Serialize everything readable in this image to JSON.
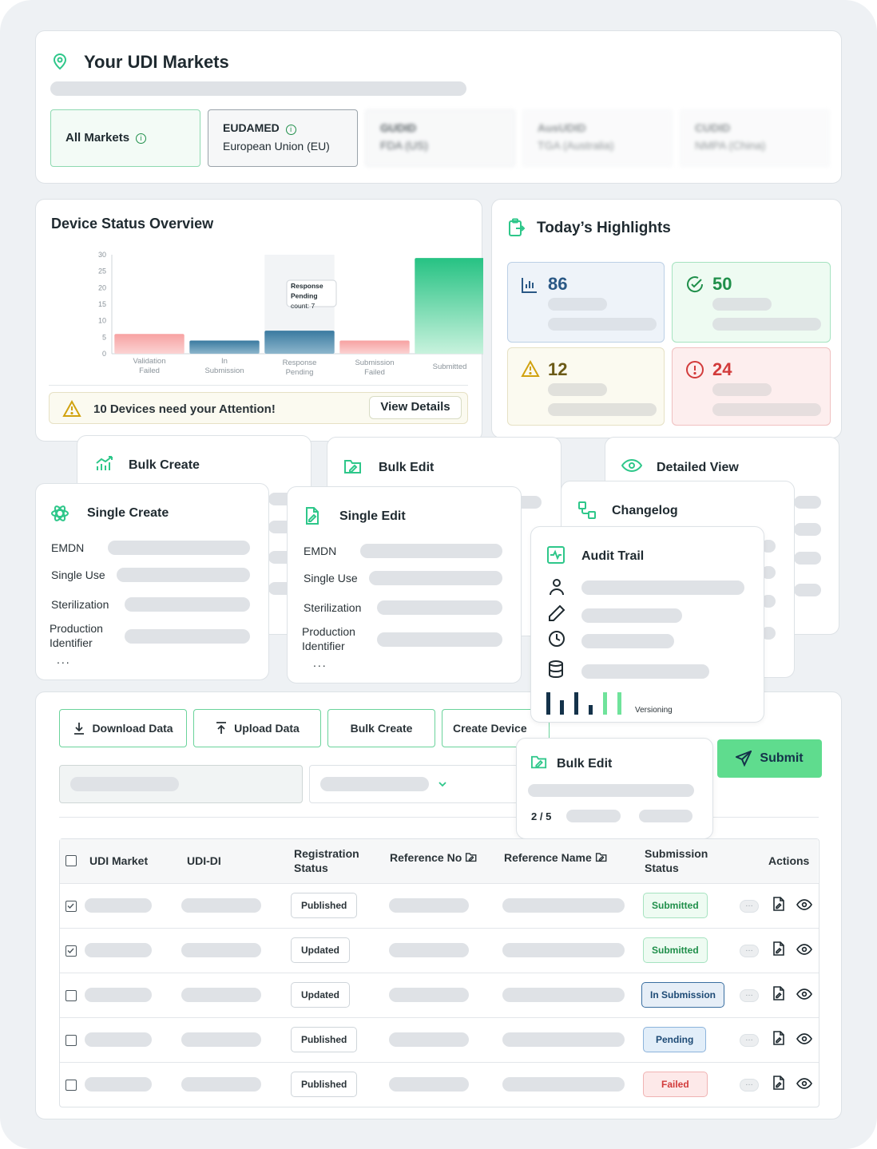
{
  "markets": {
    "title": "Your UDI Markets",
    "items": [
      {
        "name": "All Markets",
        "region": ""
      },
      {
        "name": "EUDAMED",
        "region": "European Union (EU)"
      },
      {
        "name": "GUDID",
        "region": "FDA (US)"
      },
      {
        "name": "AusUDID",
        "region": "TGA (Australia)"
      },
      {
        "name": "CUDID",
        "region": "NMPA (China)"
      }
    ]
  },
  "overview": {
    "title": "Device Status Overview",
    "tooltip": {
      "line1": "Response",
      "line2": "Pending",
      "line3": "count: 7"
    },
    "alert": "10 Devices need your Attention!",
    "view_details": "View Details"
  },
  "chart_data": {
    "type": "bar",
    "categories": [
      "Validation Failed",
      "In Submission",
      "Response Pending",
      "Submission Failed",
      "Submitted"
    ],
    "values": [
      6,
      4,
      7,
      4,
      29
    ],
    "ylim": [
      0,
      30
    ],
    "yticks": [
      0,
      5,
      10,
      15,
      20,
      25,
      30
    ],
    "colors": [
      "#f79e9e",
      "#3f7fa4",
      "#3f7fa4",
      "#f79e9e",
      "#2ec78a"
    ]
  },
  "highlights": {
    "title": "Today’s Highlights",
    "items": [
      {
        "value": "86",
        "color": "#2a5885"
      },
      {
        "value": "50",
        "color": "#1f8f4a"
      },
      {
        "value": "12",
        "color": "#6b5a16"
      },
      {
        "value": "24",
        "color": "#d23b3b"
      }
    ]
  },
  "features": {
    "bulk_create": "Bulk Create",
    "bulk_edit": "Bulk Edit",
    "detailed_view": "Detailed View",
    "single_create": "Single Create",
    "single_edit": "Single Edit",
    "changelog": "Changelog",
    "audit_trail": "Audit Trail",
    "versioning": "Versioning",
    "fields": [
      "EMDN",
      "Single Use",
      "Sterilization",
      "Production",
      "Identifier"
    ],
    "more": "..."
  },
  "table_section": {
    "buttons": {
      "download": "Download Data",
      "upload": "Upload Data",
      "bulk_create": "Bulk Create",
      "create_device": "Create Device",
      "submit": "Submit"
    },
    "bulk_popup": {
      "title": "Bulk Edit",
      "progress": "2 / 5"
    },
    "headers": {
      "market": "UDI Market",
      "udi_di": "UDI-DI",
      "reg_status_1": "Registration",
      "reg_status_2": "Status",
      "ref_no": "Reference No",
      "ref_name": "Reference Name",
      "sub_status_1": "Submission",
      "sub_status_2": "Status",
      "actions": "Actions"
    },
    "rows": [
      {
        "checked": true,
        "registration": "Published",
        "submission": "Submitted"
      },
      {
        "checked": true,
        "registration": "Updated",
        "submission": "Submitted"
      },
      {
        "checked": false,
        "registration": "Updated",
        "submission": "In Submission"
      },
      {
        "checked": false,
        "registration": "Published",
        "submission": "Pending"
      },
      {
        "checked": false,
        "registration": "Published",
        "submission": "Failed"
      }
    ]
  }
}
